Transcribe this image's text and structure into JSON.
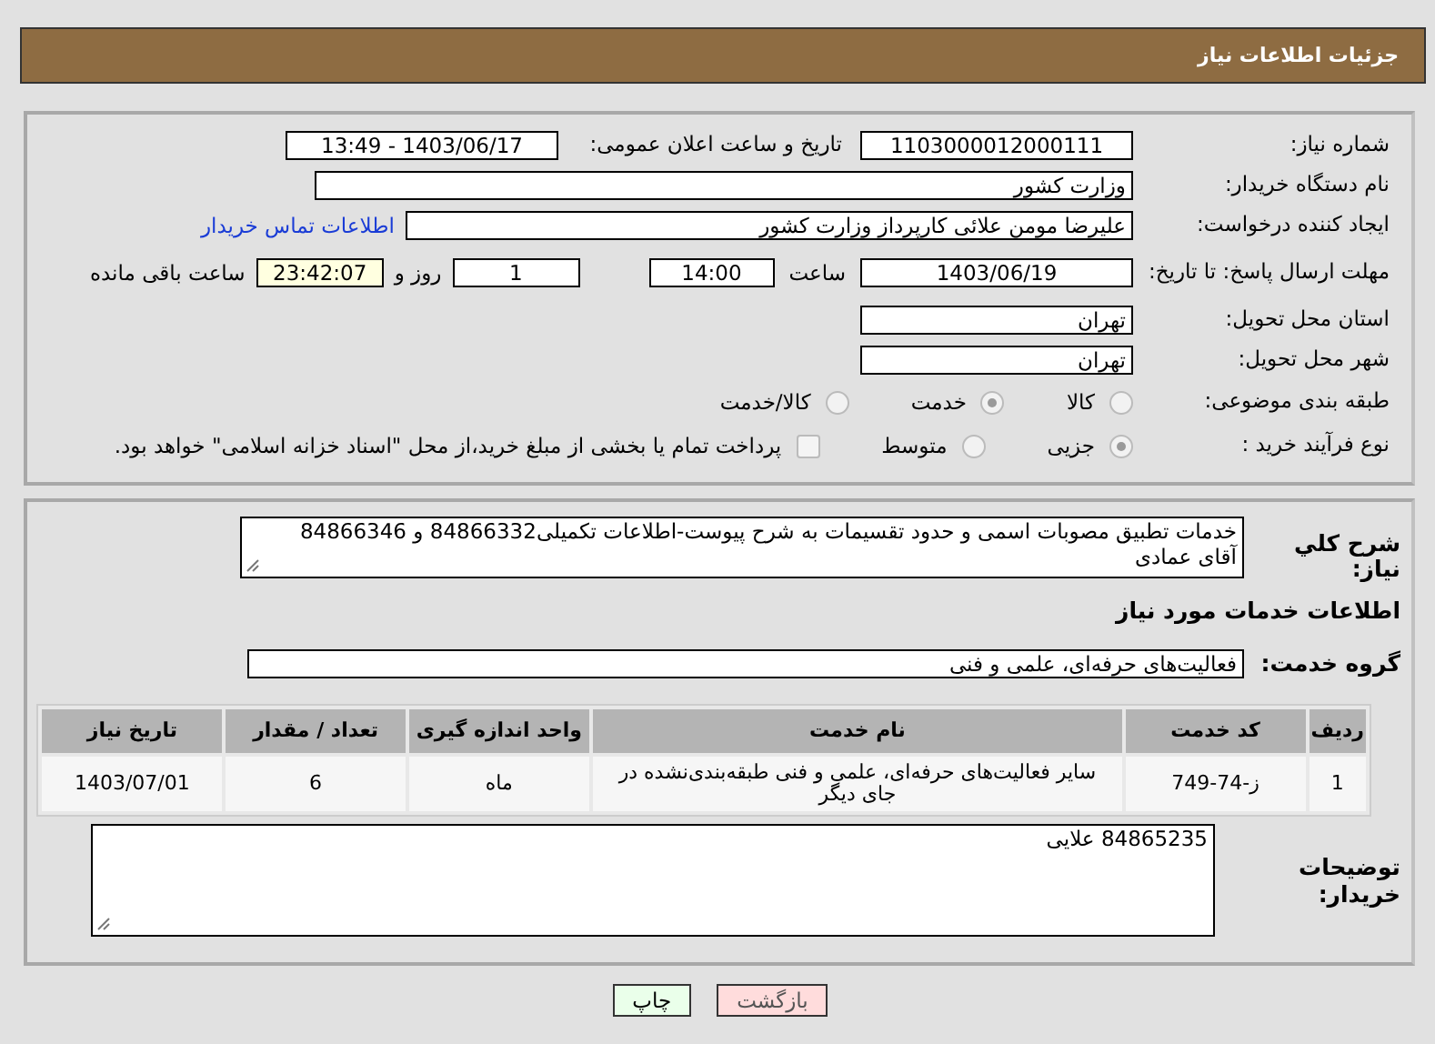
{
  "header": {
    "title": "جزئیات اطلاعات نیاز"
  },
  "need_number": {
    "label": "شماره نیاز:",
    "value": "1103000012000111"
  },
  "announce": {
    "label": "تاریخ و ساعت اعلان عمومی:",
    "value": "1403/06/17 - 13:49"
  },
  "buyer_org": {
    "label": "نام دستگاه خریدار:",
    "value": "وزارت کشور"
  },
  "requester": {
    "label": "ایجاد کننده درخواست:",
    "value": "علیرضا مومن علائی کارپرداز وزارت کشور",
    "link": "اطلاعات تماس خریدار"
  },
  "deadline": {
    "label": "مهلت ارسال پاسخ: تا تاریخ:",
    "date": "1403/06/19",
    "time_label": "ساعت",
    "time": "14:00",
    "days": "1",
    "days_label": "روز و",
    "remaining": "23:42:07",
    "remaining_label": "ساعت باقی مانده"
  },
  "province": {
    "label": "استان محل تحویل:",
    "value": "تهران"
  },
  "city": {
    "label": "شهر محل تحویل:",
    "value": "تهران"
  },
  "category": {
    "label": "طبقه بندی موضوعی:",
    "options": [
      {
        "label": "کالا",
        "selected": false
      },
      {
        "label": "خدمت",
        "selected": true
      },
      {
        "label": "کالا/خدمت",
        "selected": false
      }
    ]
  },
  "process": {
    "label": "نوع فرآیند خرید :",
    "options": [
      {
        "label": "جزیی",
        "selected": true
      },
      {
        "label": "متوسط",
        "selected": false
      }
    ],
    "treasury": {
      "checked": false,
      "text": "پرداخت تمام یا بخشی از مبلغ خرید،از محل \"اسناد خزانه اسلامی\" خواهد بود."
    }
  },
  "description": {
    "label": "شرح کلي نياز:",
    "lines": [
      "خدمات تطبيق مصوبات اسمی و حدود تقسیمات به شرح پیوست-اطلاعات تکمیلی84866332 و 84866346",
      "آقای عمادی"
    ]
  },
  "services_title": "اطلاعات خدمات مورد نیاز",
  "service_group": {
    "label": "گروه خدمت:",
    "value": "فعالیت‌های حرفه‌ای، علمی و فنی"
  },
  "table": {
    "columns": [
      "ردیف",
      "کد خدمت",
      "نام خدمت",
      "واحد اندازه گیری",
      "تعداد / مقدار",
      "تاریخ نیاز"
    ],
    "rows": [
      [
        "1",
        "ز-74-749",
        "سایر فعالیت‌های حرفه‌ای، علمی و فنی طبقه‌بندی‌نشده در جای دیگر",
        "ماه",
        "6",
        "1403/07/01"
      ]
    ]
  },
  "buyer_notes": {
    "label": "توضیحات خریدار:",
    "value": "84865235 علایی"
  },
  "buttons": [
    {
      "kind": "back",
      "label": "بازگشت"
    },
    {
      "kind": "print",
      "label": "چاپ"
    }
  ]
}
